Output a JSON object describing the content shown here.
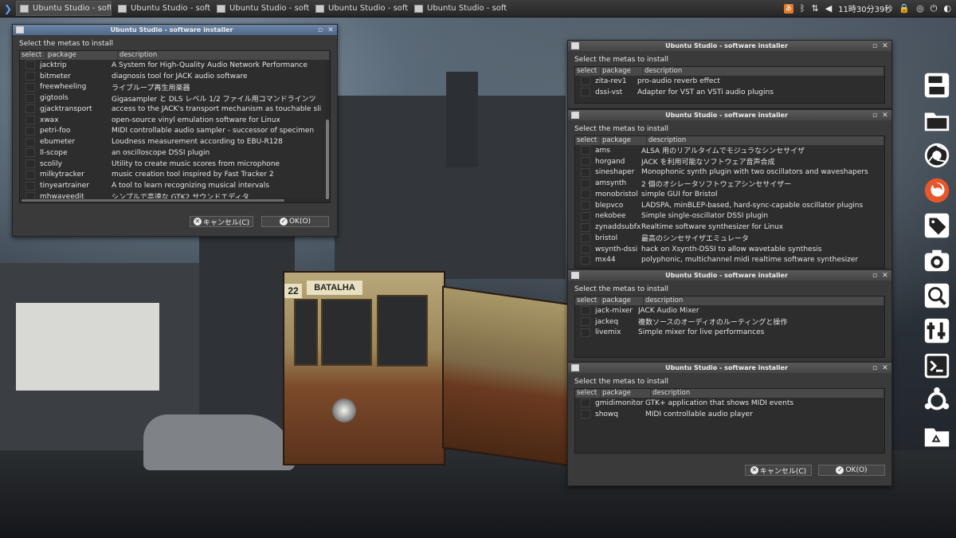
{
  "top_panel": {
    "tasks": [
      "Ubuntu Studio - softw...",
      "Ubuntu Studio - softw...",
      "Ubuntu Studio - softw...",
      "Ubuntu Studio - softw...",
      "Ubuntu Studio - softw..."
    ],
    "clock": "11時30分39秒"
  },
  "tram": {
    "sign": "BATALHA",
    "route": "22"
  },
  "dialogs": {
    "title": "Ubuntu Studio - software installer",
    "prompt": "Select the metas to install",
    "col_select": "select",
    "col_package": "package",
    "col_description": "description",
    "cancel_label": "キャンセル(C)",
    "ok_label": "OK(O)"
  },
  "win1": {
    "rows": [
      {
        "pkg": "jacktrip",
        "desc": "A System for High-Quality Audio Network Performance"
      },
      {
        "pkg": "bitmeter",
        "desc": "diagnosis tool for JACK audio software"
      },
      {
        "pkg": "freewheeling",
        "desc": "ライブループ再生用楽器"
      },
      {
        "pkg": "gigtools",
        "desc": "Gigasampler と DLS レベル 1/2 ファイル用コマンドラインツ"
      },
      {
        "pkg": "gjacktransport",
        "desc": "access to the JACK's transport mechanism as touchable sli"
      },
      {
        "pkg": "xwax",
        "desc": "open-source vinyl emulation software for Linux"
      },
      {
        "pkg": "petri-foo",
        "desc": "MIDI controllable audio sampler - successor of specimen"
      },
      {
        "pkg": "ebumeter",
        "desc": "Loudness measurement according to EBU-R128"
      },
      {
        "pkg": "ll-scope",
        "desc": "an oscilloscope DSSI plugin"
      },
      {
        "pkg": "scolily",
        "desc": "Utility to create music scores from microphone"
      },
      {
        "pkg": "milkytracker",
        "desc": "music creation tool inspired by Fast Tracker 2"
      },
      {
        "pkg": "tinyeartrainer",
        "desc": "A tool to learn recognizing musical intervals"
      },
      {
        "pkg": "mhwaveedit",
        "desc": "シンプルで高速な GTK2 サウンドエディタ"
      }
    ]
  },
  "win2": {
    "rows": [
      {
        "pkg": "zita-rev1",
        "desc": "pro-audio reverb effect"
      },
      {
        "pkg": "dssi-vst",
        "desc": "Adapter for VST an VSTi audio plugins"
      }
    ]
  },
  "win3": {
    "rows": [
      {
        "pkg": "ams",
        "desc": "ALSA 用のリアルタイムでモジュラなシンセサイザ"
      },
      {
        "pkg": "horgand",
        "desc": "JACK を利用可能なソフトウェア音声合成"
      },
      {
        "pkg": "sineshaper",
        "desc": "Monophonic synth plugin with two oscillators and waveshapers"
      },
      {
        "pkg": "amsynth",
        "desc": "2 個のオシレータソフトウェアシンセサイザー"
      },
      {
        "pkg": "monobristol",
        "desc": "simple GUI for Bristol"
      },
      {
        "pkg": "blepvco",
        "desc": "LADSPA, minBLEP-based, hard-sync-capable oscillator plugins"
      },
      {
        "pkg": "nekobee",
        "desc": "Simple single-oscillator DSSI plugin"
      },
      {
        "pkg": "zynaddsubfx",
        "desc": "Realtime software synthesizer for Linux"
      },
      {
        "pkg": "bristol",
        "desc": "最高のシンセサイザエミュレータ"
      },
      {
        "pkg": "wsynth-dssi",
        "desc": "hack on Xsynth-DSSI to allow wavetable synthesis"
      },
      {
        "pkg": "mx44",
        "desc": "polyphonic, multichannel midi realtime software synthesizer"
      }
    ]
  },
  "win4": {
    "rows": [
      {
        "pkg": "jack-mixer",
        "desc": "JACK Audio Mixer"
      },
      {
        "pkg": "jackeq",
        "desc": "複数ソースのオーディオのルーティングと操作"
      },
      {
        "pkg": "livemix",
        "desc": "Simple mixer for live performances"
      }
    ]
  },
  "win5": {
    "rows": [
      {
        "pkg": "gmidimonitor",
        "desc": "GTK+ application that shows MIDI events"
      },
      {
        "pkg": "showq",
        "desc": "MIDI controllable audio player"
      }
    ]
  },
  "dock": [
    "save-icon",
    "folder-icon",
    "chrome-icon",
    "firefox-icon",
    "tag-icon",
    "camera-icon",
    "search-icon",
    "settings-icon",
    "terminal-icon",
    "ubuntu-icon",
    "recycle-folder-icon"
  ]
}
